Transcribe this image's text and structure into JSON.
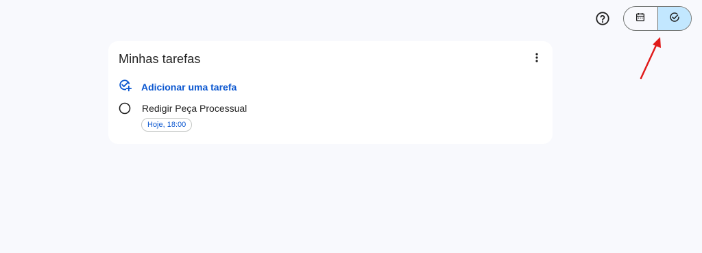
{
  "header": {
    "help_icon": "help-circle-icon",
    "view_toggle": {
      "options": [
        {
          "icon": "calendar-icon",
          "selected": false
        },
        {
          "icon": "task-check-icon",
          "selected": true
        }
      ],
      "selected_color": "#c2e7ff"
    }
  },
  "task_list": {
    "title": "Minhas tarefas",
    "more_icon": "more-vert-icon",
    "add_task_label": "Adicionar uma tarefa",
    "tasks": [
      {
        "title": "Redigir Peça Processual",
        "due": "Hoje, 18:00",
        "completed": false
      }
    ]
  },
  "colors": {
    "accent": "#0b57d0",
    "background": "#f8f9fd",
    "annotation_arrow": "#e01b1b"
  }
}
